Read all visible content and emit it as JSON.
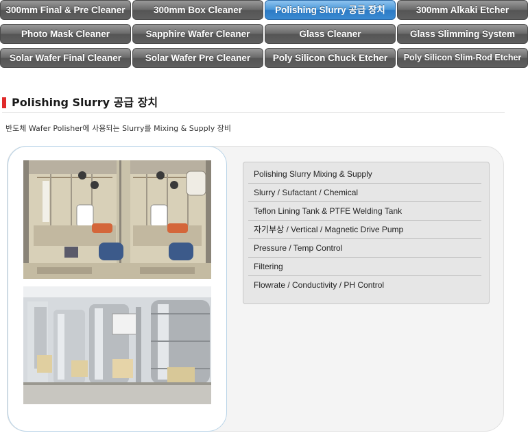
{
  "nav": {
    "tabs": [
      {
        "label": "300mm Final & Pre Cleaner",
        "active": false
      },
      {
        "label": "300mm Box Cleaner",
        "active": false
      },
      {
        "label": "Polishing Slurry 공급 장치",
        "active": true
      },
      {
        "label": "300mm Alkaki Etcher",
        "active": false
      },
      {
        "label": "Photo Mask Cleaner",
        "active": false
      },
      {
        "label": "Sapphire Wafer Cleaner",
        "active": false
      },
      {
        "label": "Glass Cleaner",
        "active": false
      },
      {
        "label": "Glass Slimming System",
        "active": false
      },
      {
        "label": "Solar Wafer Final Cleaner",
        "active": false
      },
      {
        "label": "Solar Wafer Pre Cleaner",
        "active": false
      },
      {
        "label": "Poly Silicon Chuck Etcher",
        "active": false
      },
      {
        "label": "Poly Silicon Slim-Rod Etcher",
        "active": false
      }
    ]
  },
  "page": {
    "title": "Polishing Slurry 공급 장치",
    "description": "반도체 Wafer Polisher에 사용되는 Slurry를 Mixing & Supply 장비"
  },
  "features": [
    "Polishing Slurry Mixing & Supply",
    "Slurry / Sufactant / Chemical",
    "Teflon Lining Tank & PTFE Welding Tank",
    "자기부상 / Vertical / Magnetic Drive Pump",
    "Pressure / Temp Control",
    "Filtering",
    "Flowrate / Conductivity / PH Control"
  ],
  "colors": {
    "accent": "#e02a2a",
    "tab_active": "#3a8ad2",
    "tab_inactive": "#6a6a6a"
  }
}
